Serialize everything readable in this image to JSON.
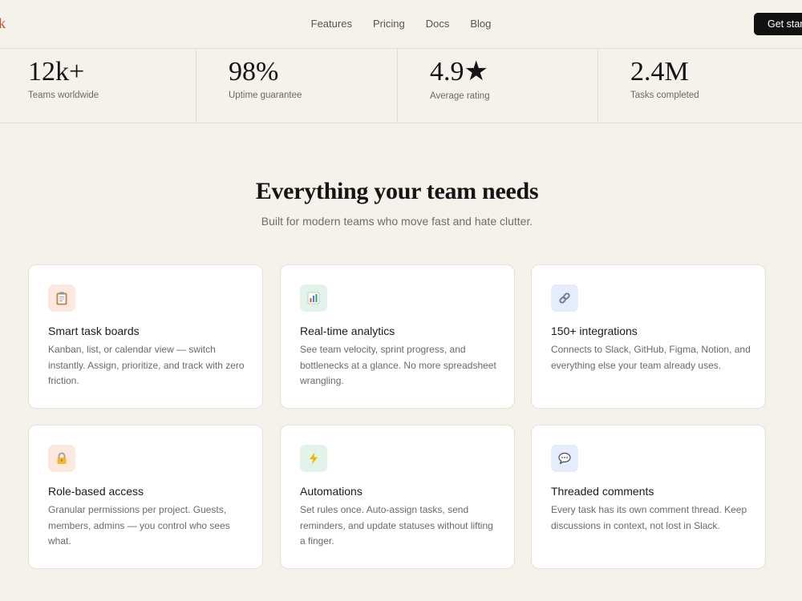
{
  "nav": {
    "logo": "k",
    "links": [
      "Features",
      "Pricing",
      "Docs",
      "Blog"
    ],
    "cta": "Get started"
  },
  "stats": [
    {
      "value": "12k+",
      "label": "Teams worldwide"
    },
    {
      "value": "98%",
      "label": "Uptime guarantee"
    },
    {
      "value": "4.9★",
      "label": "Average rating"
    },
    {
      "value": "2.4M",
      "label": "Tasks completed"
    }
  ],
  "section": {
    "title": "Everything your team needs",
    "subtitle": "Built for modern teams who move fast and hate clutter."
  },
  "features": [
    {
      "icon": "clipboard-icon",
      "title": "Smart task boards",
      "desc": "Kanban, list, or calendar view — switch instantly. Assign, prioritize, and track with zero friction."
    },
    {
      "icon": "chart-icon",
      "title": "Real-time analytics",
      "desc": "See team velocity, sprint progress, and bottlenecks at a glance. No more spreadsheet wrangling."
    },
    {
      "icon": "link-icon",
      "title": "150+ integrations",
      "desc": "Connects to Slack, GitHub, Figma, Notion, and everything else your team already uses."
    },
    {
      "icon": "lock-icon",
      "title": "Role-based access",
      "desc": "Granular permissions per project. Guests, members, admins — you control who sees what."
    },
    {
      "icon": "lightning-icon",
      "title": "Automations",
      "desc": "Set rules once. Auto-assign tasks, send reminders, and update statuses without lifting a finger."
    },
    {
      "icon": "speech-bubble-icon",
      "title": "Threaded comments",
      "desc": "Every task has its own comment thread. Keep discussions in context, not lost in Slack."
    }
  ],
  "colors": {
    "background": "#f5f1eb",
    "accent": "#c8512d",
    "cta": "#111111",
    "icon_peach": "#fce8df",
    "icon_mint": "#e2f3ea",
    "icon_blue": "#e3edfb"
  }
}
